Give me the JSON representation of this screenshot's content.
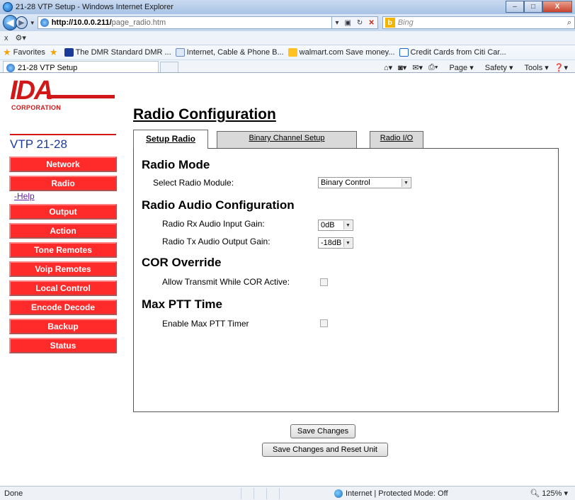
{
  "window": {
    "title": "21-28 VTP Setup - Windows Internet Explorer",
    "minimize": "–",
    "maximize": "□",
    "close": "X"
  },
  "address_bar": {
    "url_host": "http://10.0.0.211/",
    "url_path": "page_radio.htm",
    "search_placeholder": "Bing"
  },
  "command_row": {
    "close_tab": "x"
  },
  "favorites_bar": {
    "favorites_label": "Favorites",
    "links": [
      "The DMR Standard DMR ...",
      "Internet, Cable & Phone B...",
      "walmart.com Save money...",
      "Credit Cards from Citi Car..."
    ]
  },
  "browser_tab": {
    "label": "21-28 VTP Setup"
  },
  "tools_menu": {
    "page": "Page",
    "safety": "Safety",
    "tools": "Tools"
  },
  "logo": {
    "main": "IDA",
    "sub": "CORPORATION"
  },
  "device_name": "VTP 21-28",
  "sidebar": {
    "items": [
      {
        "label": "Network"
      },
      {
        "label": "Radio"
      },
      {
        "label": "Output"
      },
      {
        "label": "Action"
      },
      {
        "label": "Tone Remotes"
      },
      {
        "label": "Voip Remotes"
      },
      {
        "label": "Local Control"
      },
      {
        "label": "Encode Decode"
      },
      {
        "label": "Backup"
      },
      {
        "label": "Status"
      }
    ],
    "help_link": "-Help"
  },
  "page_title": "Radio Configuration",
  "tabs": [
    {
      "label": "Setup Radio",
      "active": true
    },
    {
      "label": "Binary Channel Setup",
      "active": false
    },
    {
      "label": "Radio I/O",
      "active": false
    }
  ],
  "radio_mode": {
    "heading": "Radio Mode",
    "module_label": "Select Radio Module:",
    "module_value": "Binary Control"
  },
  "audio_config": {
    "heading": "Radio Audio Configuration",
    "rx_label": "Radio Rx Audio Input Gain:",
    "rx_value": "0dB",
    "tx_label": "Radio Tx Audio Output Gain:",
    "tx_value": "-18dB"
  },
  "cor_override": {
    "heading": "COR Override",
    "label": "Allow Transmit While COR Active:",
    "checked": false
  },
  "max_ptt": {
    "heading": "Max PTT Time",
    "label": "Enable Max PTT Timer",
    "checked": false
  },
  "buttons": {
    "save": "Save Changes",
    "save_reset": "Save Changes and Reset Unit"
  },
  "status_bar": {
    "status": "Done",
    "zone": "Internet | Protected Mode: Off",
    "zoom": "125%"
  },
  "colors": {
    "nav_button": "#ff2b2b",
    "brand_red": "#d01818",
    "device_name": "#1a3a9a"
  }
}
